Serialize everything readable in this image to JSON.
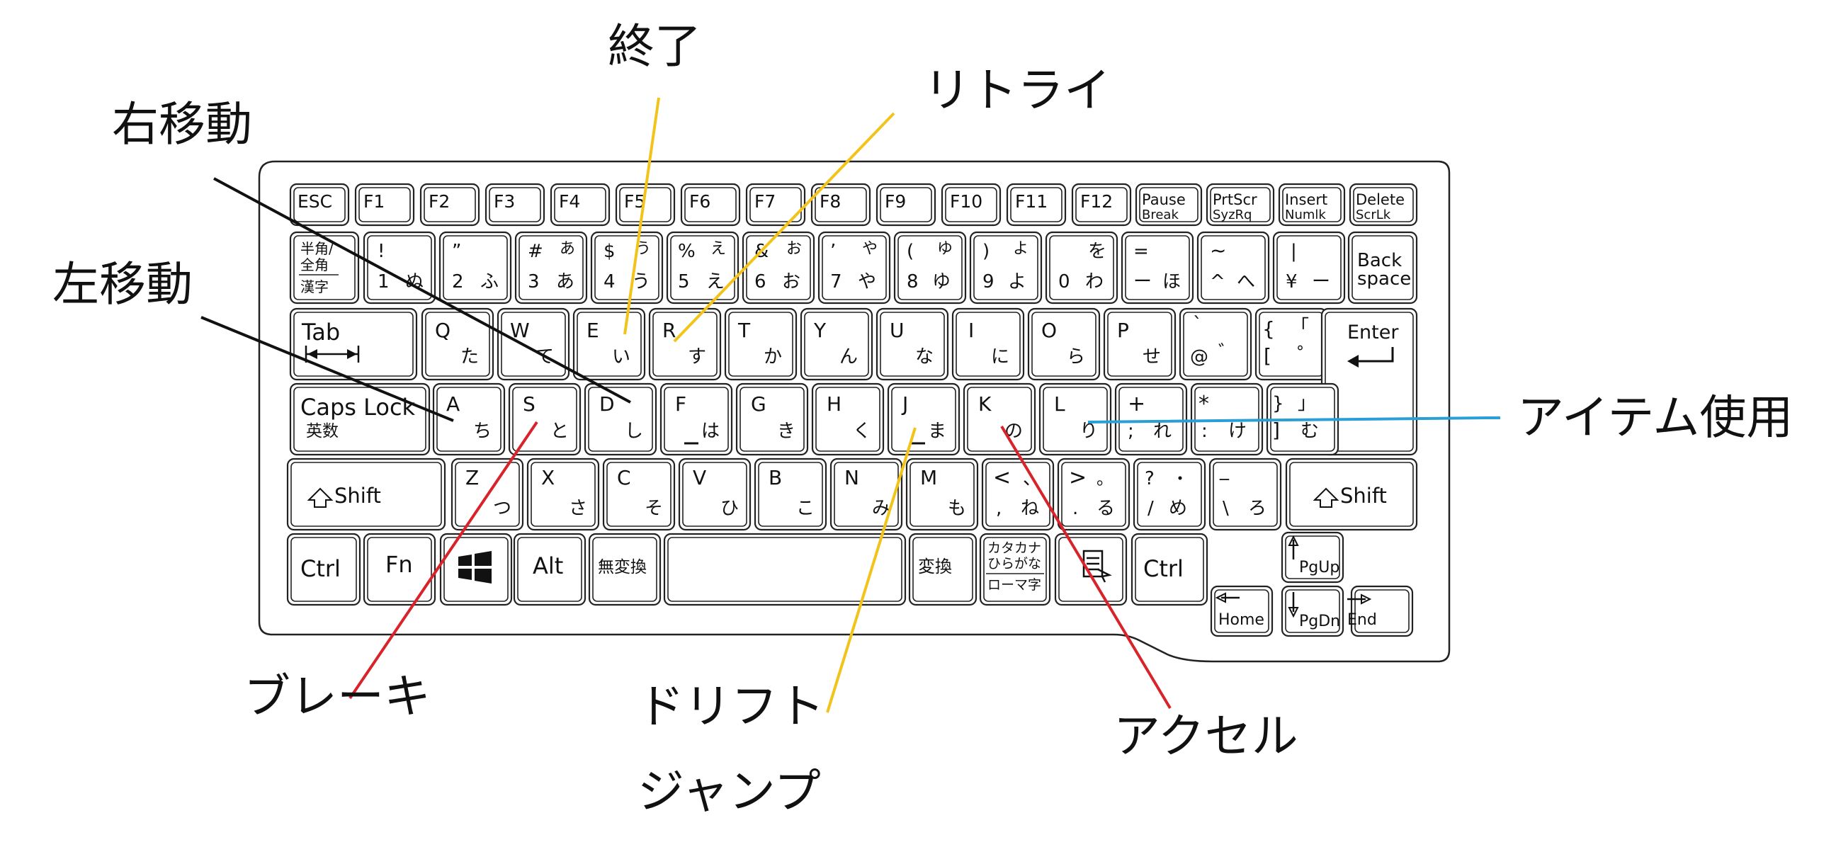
{
  "annotations": {
    "end": "終了",
    "retry": "リトライ",
    "move_right": "右移動",
    "move_left": "左移動",
    "use_item": "アイテム使用",
    "brake": "ブレーキ",
    "drift": "ドリフト",
    "jump": "ジャンプ",
    "accel": "アクセル"
  },
  "keys": {
    "esc": "ESC",
    "f1": "F1",
    "f2": "F2",
    "f3": "F3",
    "f4": "F4",
    "f5": "F5",
    "f6": "F6",
    "f7": "F7",
    "f8": "F8",
    "f9": "F9",
    "f10": "F10",
    "f11": "F11",
    "f12": "F12",
    "pause_1": "Pause",
    "pause_2": "Break",
    "prtscr_1": "PrtScr",
    "prtscr_2": "SyzRq",
    "insert_1": "Insert",
    "insert_2": "Numlk",
    "delete_1": "Delete",
    "delete_2": "ScrLk",
    "hankaku_1": "半角/",
    "hankaku_2": "全角",
    "hankaku_3": "漢字",
    "n1_s": "!",
    "n1": "1",
    "n1_k": "ぬ",
    "n2_s": "”",
    "n2": "2",
    "n2_k": "ふ",
    "n3_s": "#",
    "n3_ks": "あ",
    "n3": "3",
    "n3_k": "あ",
    "n4_s": "$",
    "n4_ks": "う",
    "n4": "4",
    "n4_k": "う",
    "n5_s": "%",
    "n5_ks": "え",
    "n5": "5",
    "n5_k": "え",
    "n6_s": "&",
    "n6_ks": "お",
    "n6": "6",
    "n6_k": "お",
    "n7_s": "’",
    "n7_ks": "や",
    "n7": "7",
    "n7_k": "や",
    "n8_s": "(",
    "n8_ks": "ゆ",
    "n8": "8",
    "n8_k": "ゆ",
    "n9_s": ")",
    "n9_ks": "よ",
    "n9": "9",
    "n9_k": "よ",
    "n0_ks": "を",
    "n0": "0",
    "n0_k": "わ",
    "minus_s": "=",
    "minus": "ー",
    "minus_k": "ほ",
    "caret_s": "~",
    "caret": "^",
    "caret_k": "へ",
    "yen_s": "|",
    "yen": "¥",
    "yen_k": "ー",
    "back_1": "Back",
    "back_2": "space",
    "tab": "Tab",
    "q": "Q",
    "q_k": "た",
    "w": "W",
    "w_k": "て",
    "e": "E",
    "e_k": "い",
    "r": "R",
    "r_k": "す",
    "t": "T",
    "t_k": "か",
    "y": "Y",
    "y_k": "ん",
    "u": "U",
    "u_k": "な",
    "i": "I",
    "i_k": "に",
    "o": "O",
    "o_k": "ら",
    "p": "P",
    "p_k": "せ",
    "at_s": "`",
    "at": "@",
    "at_k": "゛",
    "lbr_s": "{",
    "lbr_ks": "「",
    "lbr": "[",
    "lbr_k": "°",
    "enter": "Enter",
    "caps_1": "Caps Lock",
    "caps_2": "英数",
    "a": "A",
    "a_k": "ち",
    "s": "S",
    "s_k": "と",
    "d": "D",
    "d_k": "し",
    "f": "F",
    "f_k": "は",
    "g": "G",
    "g_k": "き",
    "h": "H",
    "h_k": "く",
    "j": "J",
    "j_k": "ま",
    "k": "K",
    "k_k": "の",
    "l": "L",
    "l_k": "り",
    "semi_s": "+",
    "semi": ";",
    "semi_k": "れ",
    "colon_s": "*",
    "colon": ":",
    "colon_k": "け",
    "rbr_s": "}",
    "rbr_ks": "」",
    "rbr": "]",
    "rbr_k": "む",
    "shift": "Shift",
    "z": "Z",
    "z_k": "つ",
    "x": "X",
    "x_k": "さ",
    "c": "C",
    "c_k": "そ",
    "v": "V",
    "v_k": "ひ",
    "b": "B",
    "b_k": "こ",
    "n": "N",
    "n_k": "み",
    "m": "M",
    "m_k": "も",
    "comma_s": "<",
    "comma_ks": "、",
    "comma": ",",
    "comma_k": "ね",
    "period_s": ">",
    "period_ks": "。",
    "period": ".",
    "period_k": "る",
    "slash_s": "?",
    "slash_ks": "・",
    "slash": "/",
    "slash_k": "め",
    "bslash_s": "_",
    "bslash": "\\",
    "bslash_k": "ろ",
    "ctrl": "Ctrl",
    "fn": "Fn",
    "alt": "Alt",
    "muhenkan": "無変換",
    "henkan": "変換",
    "kana_1": "カタカナ",
    "kana_2": "ひらがな",
    "kana_3": "ローマ字",
    "pgup": "PgUp",
    "pgdn": "PgDn",
    "home": "Home",
    "end": "End"
  },
  "colors": {
    "black": "#111111",
    "yellow": "#f2c41b",
    "blue": "#2a9fd6",
    "red": "#d8232a"
  }
}
